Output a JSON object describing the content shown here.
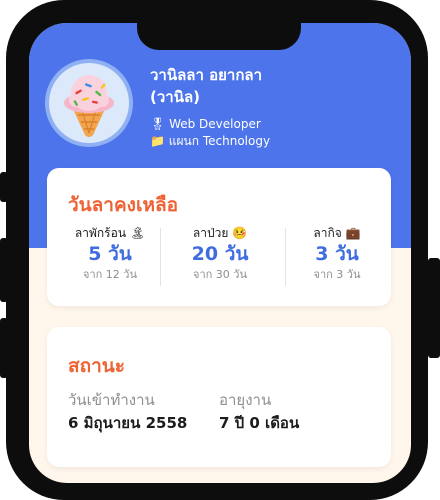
{
  "profile": {
    "name_line1": "วานิลลา อยากลา",
    "name_line2": "(วานิล)",
    "role_icon": "medal-icon",
    "role": "Web Developer",
    "department_icon": "folder-icon",
    "department": "แผนก Technology"
  },
  "leave_card": {
    "title": "วันลาคงเหลือ",
    "items": [
      {
        "label": "ลาพักร้อน 🏝",
        "value": "5 วัน",
        "total": "จาก 12 วัน"
      },
      {
        "label": "ลาป่วย 🤒",
        "value": "20 วัน",
        "total": "จาก 30 วัน"
      },
      {
        "label": "ลากิจ 💼",
        "value": "3 วัน",
        "total": "จาก 3 วัน"
      }
    ]
  },
  "status_card": {
    "title": "สถานะ",
    "start_label": "วันเข้าทำงาน",
    "start_value": "6 มิถุนายน 2558",
    "tenure_label": "อายุงาน",
    "tenure_value": "7 ปี 0 เดือน"
  },
  "colors": {
    "header": "#4d74ea",
    "accent_orange": "#ee6234",
    "accent_blue": "#3f6ddf",
    "screen_bg": "#fff6ec"
  }
}
